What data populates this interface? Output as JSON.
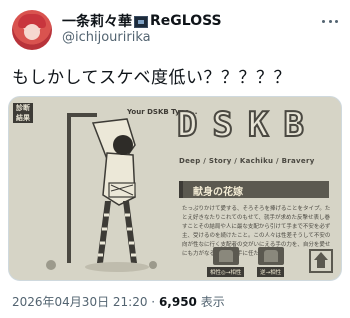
{
  "author": {
    "display_name": "一条莉々華",
    "display_name_suffix": "ReGLOSS",
    "handle": "@ichijouririka"
  },
  "tweet": {
    "text": "もしかしてスケベ度低い？？？？？"
  },
  "media": {
    "tag": "診断\n結果",
    "type_label": "Your DSKB Type...",
    "letters": [
      "D",
      "S",
      "K",
      "B"
    ],
    "subtitle": "Deep / Story / Kachiku / Bravery",
    "title": "献身の花嫁",
    "description": "たっぷりかけて愛する、そろそろを捧げることをタイプ。たとえ好きなたりこれてのもせて、就手が求めた反撃せ表し巻すことその結局や人に最な支配から引けて手まで不安を必ず主、受けるのを続けたこと。この人々は性差そうして不安の向が性なに行く支配者の交がいにえる手の力を、自分を愛せにも力がなるような相手に任たこと。",
    "compat_good_label": "相性◎→相性",
    "compat_bad_label": "逆→相性"
  },
  "meta": {
    "timestamp": "2026年04月30日 21:20",
    "separator": " · ",
    "views": "6,950",
    "views_label": " 表示"
  },
  "colors": {
    "media_bg": "#d6d4c6",
    "dark": "#3d3b36",
    "mid": "#5b5950"
  }
}
